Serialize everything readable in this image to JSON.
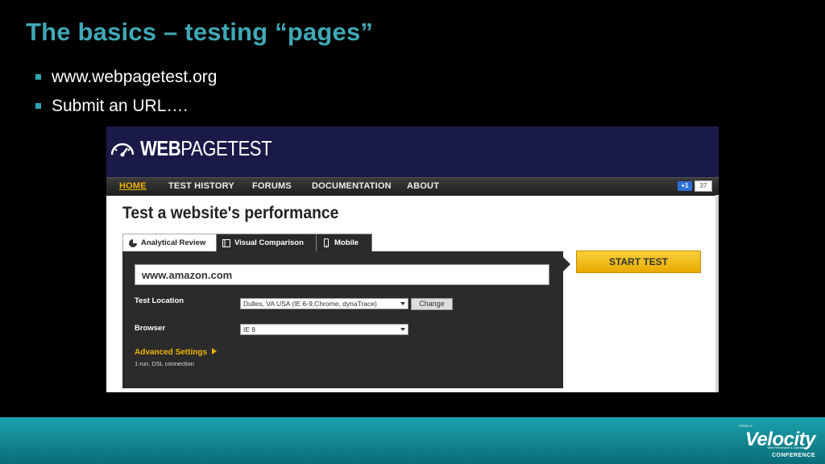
{
  "slide": {
    "title": "The basics – testing “pages”",
    "bullets": [
      "www.webpagetest.org",
      "Submit an URL…."
    ]
  },
  "webpagetest": {
    "logo_bold": "WEB",
    "logo_light": "PAGETEST",
    "nav": [
      "HOME",
      "TEST HISTORY",
      "FORUMS",
      "DOCUMENTATION",
      "ABOUT"
    ],
    "gplus_label": "+1",
    "gplus_count": "37",
    "page_heading": "Test a website's performance",
    "tabs": [
      "Analytical Review",
      "Visual Comparison",
      "Mobile"
    ],
    "url_value": "www.amazon.com",
    "test_location_label": "Test Location",
    "test_location_value": "Dulles, VA USA (IE 6-9,Chrome, dynaTrace)",
    "change_button": "Change",
    "browser_label": "Browser",
    "browser_value": "IE 8",
    "advanced_settings": "Advanced Settings",
    "advanced_note": "1 run, DSL connection",
    "start_button": "START TEST"
  },
  "footer": {
    "oreilly": "O'REILLY",
    "brand": "Velocity",
    "tagline": "Web Performance & Operations",
    "conference": "CONFERENCE"
  },
  "colors": {
    "title": "#3fa9b6",
    "header_bg": "#1a1a48",
    "accent_yellow": "#f0b400",
    "footer_teal": "#1aa2ad"
  }
}
